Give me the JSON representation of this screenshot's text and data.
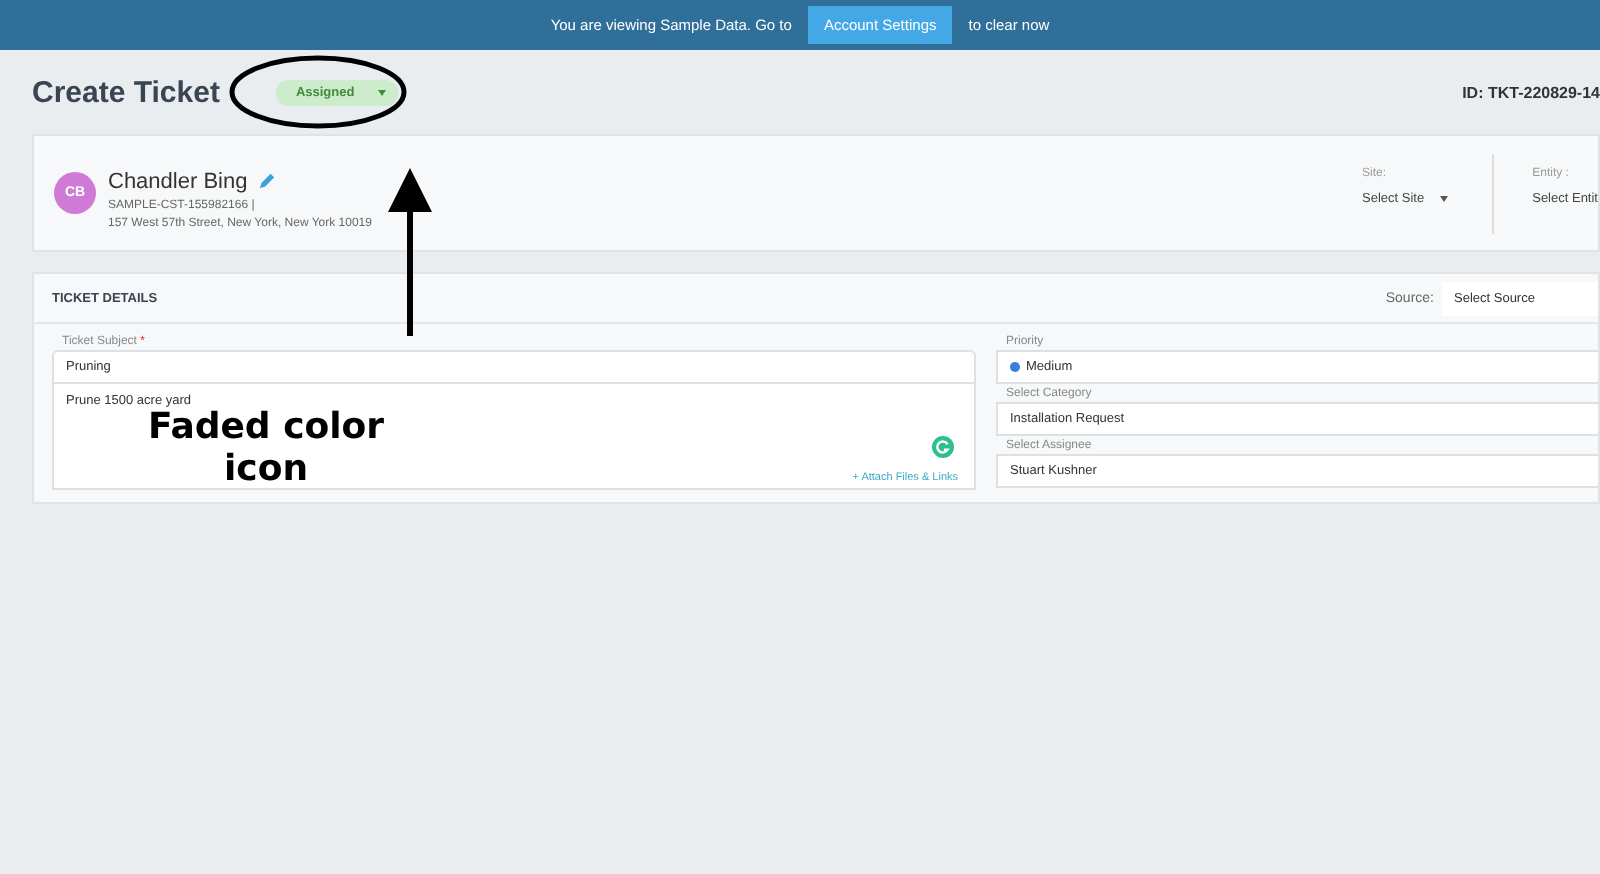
{
  "banner": {
    "text_before": "You are viewing Sample Data. Go to",
    "button": "Account Settings",
    "text_after": "to clear now"
  },
  "header": {
    "title": "Create Ticket",
    "status": "Assigned",
    "ticket_id": "ID: TKT-220829-14"
  },
  "customer": {
    "initials": "CB",
    "name": "Chandler Bing",
    "code": "SAMPLE-CST-155982166 |",
    "address": "157 West 57th Street, New York, New York 10019",
    "site_label": "Site:",
    "site_value": "Select Site",
    "entity_label": "Entity :",
    "entity_value": "Select Entit"
  },
  "ticket_details": {
    "title": "TICKET DETAILS",
    "source_label": "Source:",
    "source_value": "Select Source",
    "subject_label": "Ticket Subject",
    "required_mark": "*",
    "subject_value": "Pruning",
    "description": "Prune 1500 acre yard",
    "attach_link": "+ Attach Files & Links",
    "fields": [
      {
        "label": "Priority",
        "value": "Medium",
        "kind": "priority"
      },
      {
        "label": "Select Category",
        "value": "Installation Request",
        "kind": "select"
      },
      {
        "label": "Select Assignee",
        "value": "Stuart Kushner",
        "kind": "select"
      }
    ]
  },
  "annotation": {
    "text": "Faded color icon"
  }
}
